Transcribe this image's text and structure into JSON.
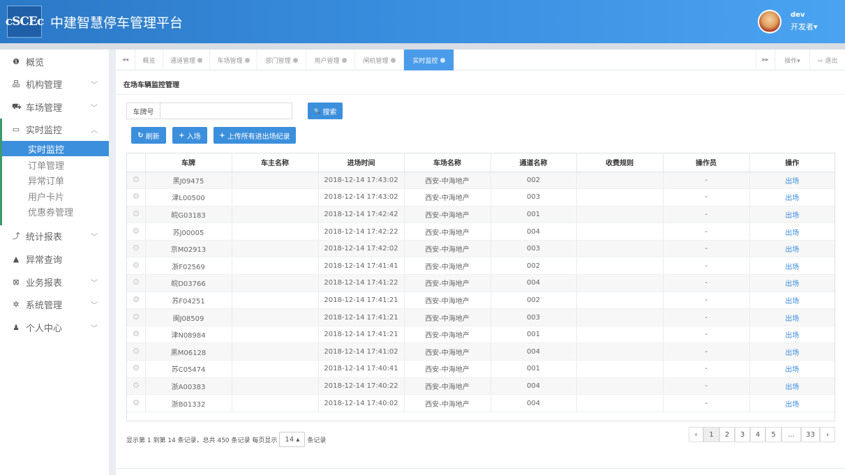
{
  "header": {
    "logo_text": "cSCEc",
    "title": "中建智慧停车管理平台",
    "user_name": "dev",
    "user_role": "开发者▾"
  },
  "sidebar": {
    "items": [
      {
        "label": "概览",
        "icon": "info-circle-icon",
        "glyph": "❶"
      },
      {
        "label": "机构管理",
        "icon": "sitemap-icon",
        "glyph": "品",
        "chev": "﹀"
      },
      {
        "label": "车场管理",
        "icon": "car-icon",
        "glyph": "⛟",
        "chev": "﹀"
      },
      {
        "label": "实时监控",
        "icon": "monitor-icon",
        "glyph": "▭",
        "chev": "︿"
      },
      {
        "label": "统计报表",
        "icon": "line-chart-icon",
        "glyph": "⤴",
        "chev": "﹀"
      },
      {
        "label": "异常查询",
        "icon": "warning-icon",
        "glyph": "▲"
      },
      {
        "label": "业务报表",
        "icon": "file-excel-icon",
        "glyph": "⊠",
        "chev": "﹀"
      },
      {
        "label": "系统管理",
        "icon": "gear-icon",
        "glyph": "✲",
        "chev": "﹀"
      },
      {
        "label": "个人中心",
        "icon": "user-icon",
        "glyph": "♟",
        "chev": "﹀"
      }
    ],
    "subitems": [
      {
        "label": "实时监控"
      },
      {
        "label": "订单管理"
      },
      {
        "label": "异常订单"
      },
      {
        "label": "用户卡片"
      },
      {
        "label": "优惠券管理"
      }
    ]
  },
  "tabs": {
    "prev": "◂◂",
    "next": "▸▸",
    "items": [
      "概览",
      "通道管理",
      "车场管理",
      "部门管理",
      "用户管理",
      "闸机管理",
      "实时监控"
    ],
    "actions_label": "操作▾",
    "logout_label": "⇨ 退出"
  },
  "panel": {
    "title": "在场车辆监控管理"
  },
  "search": {
    "label": "车牌号",
    "value": "",
    "button": "搜索",
    "button_icon": "🔍"
  },
  "toolbar": {
    "refresh": "刷新",
    "refresh_icon": "↻",
    "enter": "入场",
    "enter_icon": "+",
    "upload": "上传所有进出场纪录",
    "upload_icon": "+"
  },
  "table": {
    "columns": [
      "",
      "车牌",
      "车主名称",
      "进场时间",
      "车场名称",
      "通道名称",
      "收费规则",
      "操作员",
      "操作"
    ],
    "rows": [
      {
        "plate": "黑J09475",
        "owner": "",
        "time": "2018-12-14 17:43:02",
        "park": "西安-中海地产",
        "channel": "002",
        "rule": "",
        "operator": "-",
        "action": "出场"
      },
      {
        "plate": "津L00500",
        "owner": "",
        "time": "2018-12-14 17:43:02",
        "park": "西安-中海地产",
        "channel": "003",
        "rule": "",
        "operator": "-",
        "action": "出场"
      },
      {
        "plate": "皖G03183",
        "owner": "",
        "time": "2018-12-14 17:42:42",
        "park": "西安-中海地产",
        "channel": "001",
        "rule": "",
        "operator": "-",
        "action": "出场"
      },
      {
        "plate": "苏J00005",
        "owner": "",
        "time": "2018-12-14 17:42:22",
        "park": "西安-中海地产",
        "channel": "004",
        "rule": "",
        "operator": "-",
        "action": "出场"
      },
      {
        "plate": "京M02913",
        "owner": "",
        "time": "2018-12-14 17:42:02",
        "park": "西安-中海地产",
        "channel": "003",
        "rule": "",
        "operator": "-",
        "action": "出场"
      },
      {
        "plate": "浙F02569",
        "owner": "",
        "time": "2018-12-14 17:41:41",
        "park": "西安-中海地产",
        "channel": "002",
        "rule": "",
        "operator": "-",
        "action": "出场"
      },
      {
        "plate": "皖D03766",
        "owner": "",
        "time": "2018-12-14 17:41:22",
        "park": "西安-中海地产",
        "channel": "004",
        "rule": "",
        "operator": "-",
        "action": "出场"
      },
      {
        "plate": "苏F04251",
        "owner": "",
        "time": "2018-12-14 17:41:21",
        "park": "西安-中海地产",
        "channel": "002",
        "rule": "",
        "operator": "-",
        "action": "出场"
      },
      {
        "plate": "闽J08509",
        "owner": "",
        "time": "2018-12-14 17:41:21",
        "park": "西安-中海地产",
        "channel": "003",
        "rule": "",
        "operator": "-",
        "action": "出场"
      },
      {
        "plate": "津N08984",
        "owner": "",
        "time": "2018-12-14 17:41:21",
        "park": "西安-中海地产",
        "channel": "001",
        "rule": "",
        "operator": "-",
        "action": "出场"
      },
      {
        "plate": "黑M06128",
        "owner": "",
        "time": "2018-12-14 17:41:02",
        "park": "西安-中海地产",
        "channel": "004",
        "rule": "",
        "operator": "-",
        "action": "出场"
      },
      {
        "plate": "苏C05474",
        "owner": "",
        "time": "2018-12-14 17:40:41",
        "park": "西安-中海地产",
        "channel": "001",
        "rule": "",
        "operator": "-",
        "action": "出场"
      },
      {
        "plate": "浙A00383",
        "owner": "",
        "time": "2018-12-14 17:40:22",
        "park": "西安-中海地产",
        "channel": "004",
        "rule": "",
        "operator": "-",
        "action": "出场"
      },
      {
        "plate": "浙B01332",
        "owner": "",
        "time": "2018-12-14 17:40:02",
        "park": "西安-中海地产",
        "channel": "004",
        "rule": "",
        "operator": "-",
        "action": "出场"
      }
    ]
  },
  "pagination": {
    "info_prefix": "显示第 1 到第 14 条记录，总共 450 条记录 每页显示",
    "page_size": "14 ▴",
    "info_suffix": "条记录",
    "pages": [
      "‹",
      "1",
      "2",
      "3",
      "4",
      "5",
      "...",
      "33",
      "›"
    ],
    "current": "1"
  },
  "colors": {
    "header_gradient_start": "#2b78c6",
    "accent": "#3c8fdc",
    "sidebar_accent": "#3c9a6e",
    "link": "#3a8be0"
  }
}
